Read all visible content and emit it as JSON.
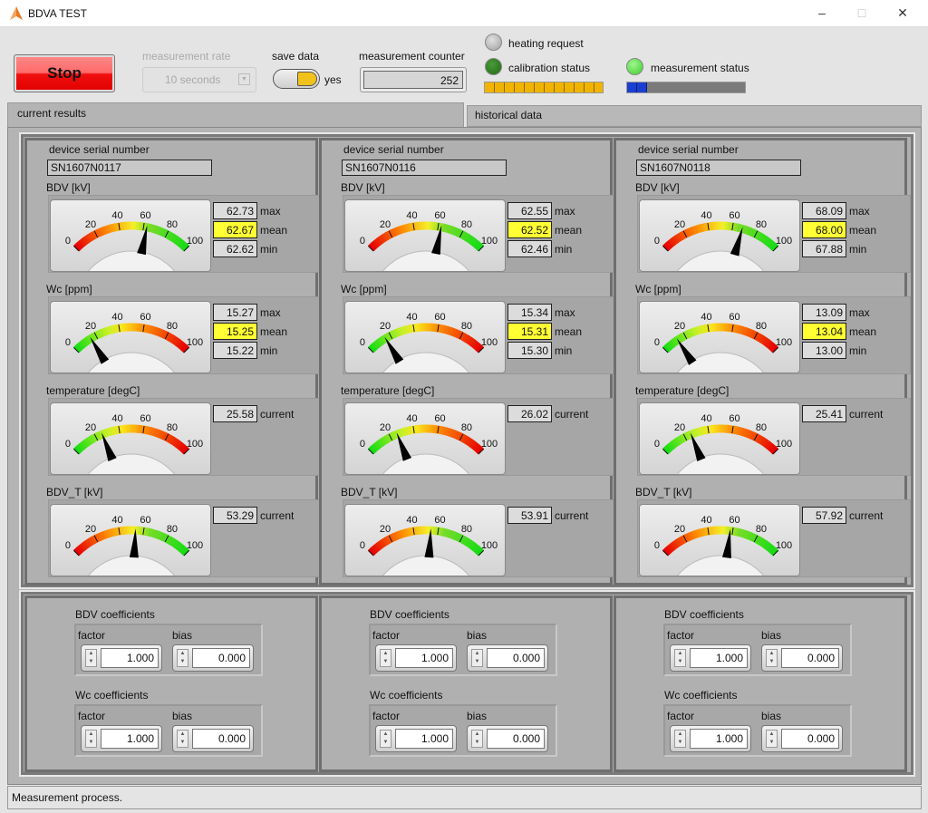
{
  "window": {
    "title": "BDVA TEST",
    "min_icon": "minimize-icon",
    "max_icon": "maximize-icon",
    "close_icon": "close-icon"
  },
  "toolbar": {
    "stop_label": "Stop",
    "rate_label": "measurement rate",
    "rate_value": "10 seconds",
    "save_label": "save data",
    "save_value": "yes",
    "save_on": true,
    "counter_label": "measurement counter",
    "counter_value": "252",
    "heating_label": "heating request",
    "heating_color": "#a0a0a0",
    "calibration_label": "calibration status",
    "calibration_color": "#1f6b12",
    "calibration_progress": 100,
    "calibration_bar_color": "#f0b400",
    "measurement_label": "measurement status",
    "measurement_color": "#3ccf2a",
    "measurement_progress": 17,
    "measurement_bar_color": "#1a3fd0"
  },
  "tabs": [
    {
      "label": "current results",
      "selected": true
    },
    {
      "label": "historical data",
      "selected": false
    }
  ],
  "devices": [
    {
      "serial_label": "device serial number",
      "serial": "SN1607N0117",
      "gauges": [
        {
          "label": "BDV [kV]",
          "scale": "red-yellow-green",
          "value": 62.67,
          "readouts": [
            {
              "value": "62.73",
              "label": "max"
            },
            {
              "value": "62.67",
              "label": "mean",
              "highlight": true
            },
            {
              "value": "62.62",
              "label": "min"
            }
          ]
        },
        {
          "label": "Wc [ppm]",
          "scale": "green-yellow-red",
          "value": 15.25,
          "readouts": [
            {
              "value": "15.27",
              "label": "max"
            },
            {
              "value": "15.25",
              "label": "mean",
              "highlight": true
            },
            {
              "value": "15.22",
              "label": "min"
            }
          ]
        },
        {
          "label": "temperature [degC]",
          "scale": "green-yellow-red",
          "value": 25.58,
          "readouts": [
            {
              "value": "25.58",
              "label": "current"
            }
          ]
        },
        {
          "label": "BDV_T [kV]",
          "scale": "red-yellow-green",
          "value": 53.29,
          "readouts": [
            {
              "value": "53.29",
              "label": "current"
            }
          ]
        }
      ],
      "coefficients": [
        {
          "title": "BDV coefficients",
          "factor_label": "factor",
          "factor": "1.000",
          "bias_label": "bias",
          "bias": "0.000"
        },
        {
          "title": "Wc coefficients",
          "factor_label": "factor",
          "factor": "1.000",
          "bias_label": "bias",
          "bias": "0.000"
        }
      ]
    },
    {
      "serial_label": "device serial number",
      "serial": "SN1607N0116",
      "gauges": [
        {
          "label": "BDV [kV]",
          "scale": "red-yellow-green",
          "value": 62.52,
          "readouts": [
            {
              "value": "62.55",
              "label": "max"
            },
            {
              "value": "62.52",
              "label": "mean",
              "highlight": true
            },
            {
              "value": "62.46",
              "label": "min"
            }
          ]
        },
        {
          "label": "Wc [ppm]",
          "scale": "green-yellow-red",
          "value": 15.31,
          "readouts": [
            {
              "value": "15.34",
              "label": "max"
            },
            {
              "value": "15.31",
              "label": "mean",
              "highlight": true
            },
            {
              "value": "15.30",
              "label": "min"
            }
          ]
        },
        {
          "label": "temperature [degC]",
          "scale": "green-yellow-red",
          "value": 26.02,
          "readouts": [
            {
              "value": "26.02",
              "label": "current"
            }
          ]
        },
        {
          "label": "BDV_T [kV]",
          "scale": "red-yellow-green",
          "value": 53.91,
          "readouts": [
            {
              "value": "53.91",
              "label": "current"
            }
          ]
        }
      ],
      "coefficients": [
        {
          "title": "BDV coefficients",
          "factor_label": "factor",
          "factor": "1.000",
          "bias_label": "bias",
          "bias": "0.000"
        },
        {
          "title": "Wc coefficients",
          "factor_label": "factor",
          "factor": "1.000",
          "bias_label": "bias",
          "bias": "0.000"
        }
      ]
    },
    {
      "serial_label": "device serial number",
      "serial": "SN1607N0118",
      "gauges": [
        {
          "label": "BDV [kV]",
          "scale": "red-yellow-green",
          "value": 68.0,
          "readouts": [
            {
              "value": "68.09",
              "label": "max"
            },
            {
              "value": "68.00",
              "label": "mean",
              "highlight": true
            },
            {
              "value": "67.88",
              "label": "min"
            }
          ]
        },
        {
          "label": "Wc [ppm]",
          "scale": "green-yellow-red",
          "value": 13.04,
          "readouts": [
            {
              "value": "13.09",
              "label": "max"
            },
            {
              "value": "13.04",
              "label": "mean",
              "highlight": true
            },
            {
              "value": "13.00",
              "label": "min"
            }
          ]
        },
        {
          "label": "temperature [degC]",
          "scale": "green-yellow-red",
          "value": 25.41,
          "readouts": [
            {
              "value": "25.41",
              "label": "current"
            }
          ]
        },
        {
          "label": "BDV_T [kV]",
          "scale": "red-yellow-green",
          "value": 57.92,
          "readouts": [
            {
              "value": "57.92",
              "label": "current"
            }
          ]
        }
      ],
      "coefficients": [
        {
          "title": "BDV coefficients",
          "factor_label": "factor",
          "factor": "1.000",
          "bias_label": "bias",
          "bias": "0.000"
        },
        {
          "title": "Wc coefficients",
          "factor_label": "factor",
          "factor": "1.000",
          "bias_label": "bias",
          "bias": "0.000"
        }
      ]
    }
  ],
  "gauge_ticks": [
    "0",
    "20",
    "40",
    "60",
    "80",
    "100"
  ],
  "status_bar": {
    "text": "Measurement process."
  }
}
